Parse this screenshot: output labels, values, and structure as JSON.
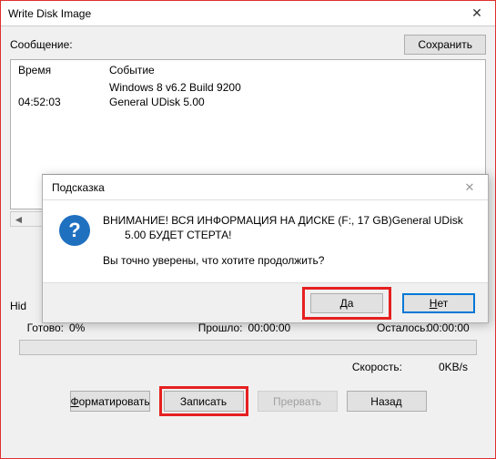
{
  "titlebar": {
    "title": "Write Disk Image"
  },
  "message": {
    "label": "Сообщение:",
    "save_label": "Сохранить"
  },
  "log": {
    "header_time": "Время",
    "header_event": "Событие",
    "rows": [
      {
        "time": "",
        "event": "Windows 8 v6.2 Build 9200"
      },
      {
        "time": "04:52:03",
        "event": "General UDisk        5.00"
      }
    ]
  },
  "hid_label": "Hid",
  "progress": {
    "ready_label": "Готово:",
    "percent": "0%",
    "elapsed_label": "Прошло:",
    "elapsed_value": "00:00:00",
    "remaining_label": "Осталось:",
    "remaining_value": "00:00:00"
  },
  "speed": {
    "label": "Скорость:",
    "value": "0KB/s"
  },
  "buttons": {
    "format_prefix": "Ф",
    "format_rest": "орматировать",
    "write_label": "Записать",
    "abort_label": "Прервать",
    "back_label": "Назад"
  },
  "dialog": {
    "title": "Подсказка",
    "line1": "ВНИМАНИЕ! ВСЯ ИНФОРМАЦИЯ НА ДИСКЕ (F:, 17 GB)General UDisk",
    "line2": "5.00 БУДЕТ СТЕРТА!",
    "question": "Вы точно уверены, что хотите продолжить?",
    "yes_prefix": "Д",
    "yes_rest": "а",
    "no_prefix": "Н",
    "no_rest": "ет"
  }
}
